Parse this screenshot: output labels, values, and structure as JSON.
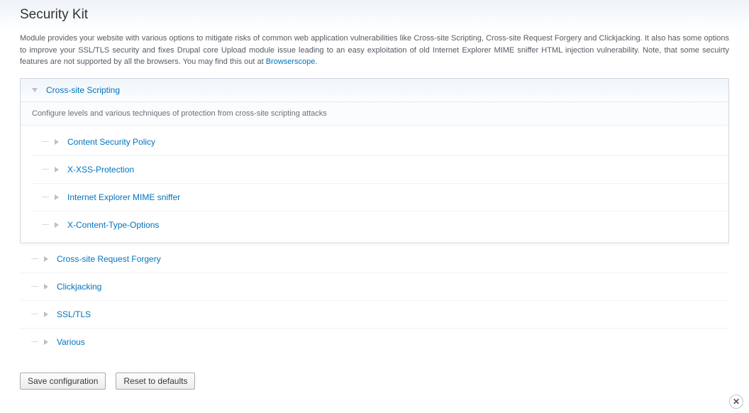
{
  "header": {
    "title": "Security Kit"
  },
  "description": {
    "text_before_link": "Module provides your website with various options to mitigate risks of common web application vulnerabilities like Cross-site Scripting, Cross-site Request Forgery and Clickjacking. It also has some options to improve your SSL/TLS security and fixes Drupal core Upload module issue leading to an easy exploitation of old Internet Explorer MIME sniffer HTML injection vulnerability. Note, that some secuirty features are not supported by all the browsers. You may find this out at ",
    "link_text": "Browserscope",
    "text_after_link": "."
  },
  "sections": {
    "xss": {
      "title": "Cross-site Scripting",
      "description": "Configure levels and various techniques of protection from cross-site scripting attacks",
      "items": [
        {
          "label": "Content Security Policy"
        },
        {
          "label": "X-XSS-Protection"
        },
        {
          "label": "Internet Explorer MIME sniffer"
        },
        {
          "label": "X-Content-Type-Options"
        }
      ]
    },
    "others": [
      {
        "label": "Cross-site Request Forgery"
      },
      {
        "label": "Clickjacking"
      },
      {
        "label": "SSL/TLS"
      },
      {
        "label": "Various"
      }
    ]
  },
  "actions": {
    "save": "Save configuration",
    "reset": "Reset to defaults"
  },
  "close_glyph": "✕"
}
